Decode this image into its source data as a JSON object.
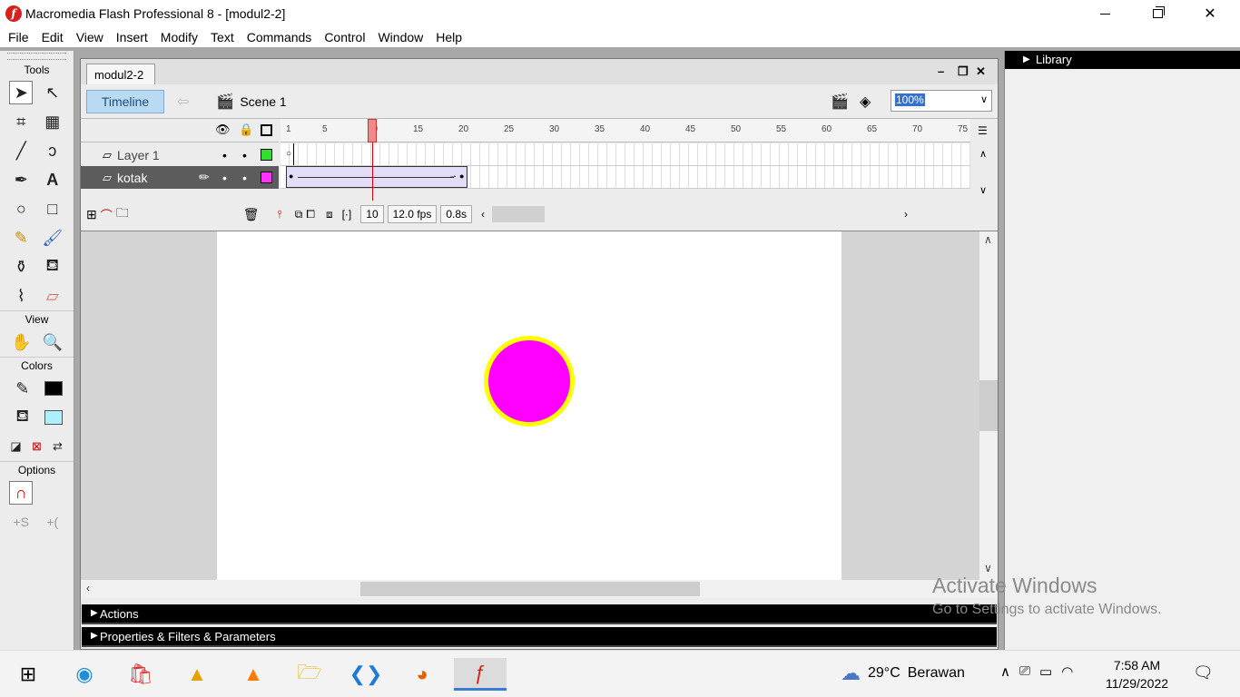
{
  "window": {
    "title": "Macromedia Flash Professional 8 - [modul2-2]",
    "app_icon_glyph": "f"
  },
  "menubar": {
    "items": [
      "File",
      "Edit",
      "View",
      "Insert",
      "Modify",
      "Text",
      "Commands",
      "Control",
      "Window",
      "Help"
    ]
  },
  "tools": {
    "tools_label": "Tools",
    "view_label": "View",
    "colors_label": "Colors",
    "options_label": "Options",
    "stroke_color": "#000000",
    "fill_color": "#aaf0ff"
  },
  "document": {
    "tab_label": "modul2-2",
    "timeline_button": "Timeline",
    "scene_label": "Scene 1",
    "zoom_value": "100%"
  },
  "timeline": {
    "ruler_numbers": [
      "1",
      "5",
      "10",
      "15",
      "20",
      "25",
      "30",
      "35",
      "40",
      "45",
      "50",
      "55",
      "60",
      "65",
      "70",
      "75"
    ],
    "layers": [
      {
        "name": "Layer 1",
        "outline_color": "#33dd33",
        "selected": false
      },
      {
        "name": "kotak",
        "outline_color": "#ff33ff",
        "selected": true
      }
    ],
    "current_frame": "10",
    "frame_rate": "12.0 fps",
    "elapsed_time": "0.8s"
  },
  "stage": {
    "circle_fill": "#ff00ff",
    "circle_stroke": "#ffff00"
  },
  "panels": {
    "actions": "Actions",
    "properties": "Properties & Filters & Parameters",
    "library": "Library"
  },
  "watermark": {
    "line1": "Activate Windows",
    "line2": "Go to Settings to activate Windows."
  },
  "taskbar": {
    "weather_temp": "29°C",
    "weather_desc": "Berawan",
    "time": "7:58 AM",
    "date": "11/29/2022"
  }
}
